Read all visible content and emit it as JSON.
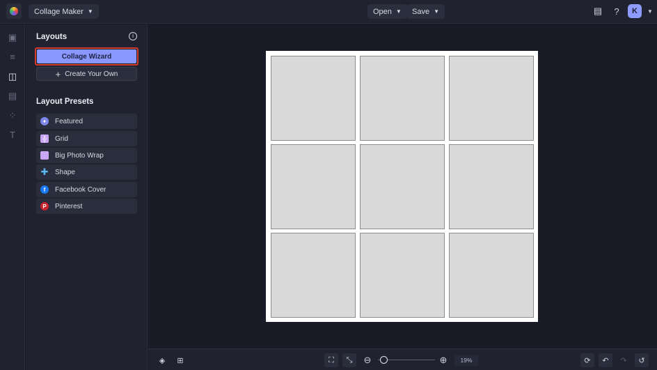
{
  "header": {
    "app_menu": "Collage Maker",
    "open": "Open",
    "save": "Save",
    "avatar": "K"
  },
  "panel": {
    "title": "Layouts",
    "wizard": "Collage Wizard",
    "create": "Create Your Own",
    "presets_title": "Layout Presets",
    "presets": [
      {
        "label": "Featured",
        "icon": "featured-icon",
        "color": "#7b86e8"
      },
      {
        "label": "Grid",
        "icon": "grid-icon",
        "color": "#c9a6f5"
      },
      {
        "label": "Big Photo Wrap",
        "icon": "big-photo-wrap-icon",
        "color": "#c9a6f5"
      },
      {
        "label": "Shape",
        "icon": "shape-icon",
        "color": "#5ab8f0"
      },
      {
        "label": "Facebook Cover",
        "icon": "facebook-icon",
        "color": "#1877f2"
      },
      {
        "label": "Pinterest",
        "icon": "pinterest-icon",
        "color": "#c8232c"
      }
    ]
  },
  "footer": {
    "zoom": "19%"
  },
  "colors": {
    "accent": "#8a97ff",
    "highlight": "#d23a2a"
  }
}
